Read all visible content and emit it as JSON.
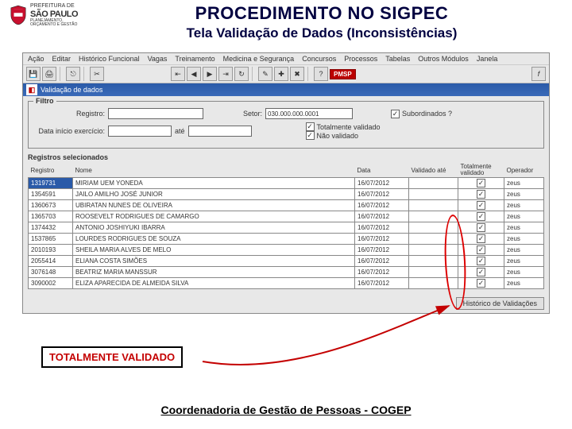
{
  "logo": {
    "line1": "PREFEITURA DE",
    "city": "SÃO PAULO",
    "line3": "PLANEJAMENTO,\nORÇAMENTO E GESTÃO"
  },
  "titles": {
    "main": "PROCEDIMENTO NO SIGPEC",
    "sub": "Tela Validação de Dados (Inconsistências)"
  },
  "menu": [
    "Ação",
    "Editar",
    "Histórico Funcional",
    "Vagas",
    "Treinamento",
    "Medicina e Segurança",
    "Concursos",
    "Processos",
    "Tabelas",
    "Outros Módulos",
    "Janela"
  ],
  "toolbar_badge": "PMSP",
  "window_title": "Validação de dados",
  "filtro": {
    "title": "Filtro",
    "registro_label": "Registro:",
    "setor_label": "Setor:",
    "setor_value": "030.000.000.0001",
    "subordinados_label": "Subordinados ?",
    "data_ini_label": "Data início exercício:",
    "ate_label": "até",
    "totvalid_label": "Totalmente validado",
    "naovalid_label": "Não validado"
  },
  "grid": {
    "section": "Registros selecionados",
    "headers": {
      "registro": "Registro",
      "nome": "Nome",
      "data": "Data",
      "valido_ate": "Validado até",
      "tot": "Totalmente validado",
      "operador": "Operador"
    },
    "rows": [
      {
        "reg": "1319731",
        "nome": "MIRIAM UEM YONEDA",
        "data": "16/07/2012",
        "op": "zeus",
        "sel": true
      },
      {
        "reg": "1354591",
        "nome": "JAILO AMILHO JOSÉ JUNIOR",
        "data": "16/07/2012",
        "op": "zeus"
      },
      {
        "reg": "1360673",
        "nome": "UBIRATAN NUNES DE OLIVEIRA",
        "data": "16/07/2012",
        "op": "zeus"
      },
      {
        "reg": "1365703",
        "nome": "ROOSEVELT RODRIGUES DE CAMARGO",
        "data": "16/07/2012",
        "op": "zeus"
      },
      {
        "reg": "1374432",
        "nome": "ANTONIO JOSHIYUKI IBARRA",
        "data": "16/07/2012",
        "op": "zeus"
      },
      {
        "reg": "1537865",
        "nome": "LOURDES RODRIGUES DE SOUZA",
        "data": "16/07/2012",
        "op": "zeus"
      },
      {
        "reg": "2010193",
        "nome": "SHEILA MARIA ALVES DE MELO",
        "data": "16/07/2012",
        "op": "zeus"
      },
      {
        "reg": "2055414",
        "nome": "ELIANA COSTA SIMÕES",
        "data": "16/07/2012",
        "op": "zeus"
      },
      {
        "reg": "3076148",
        "nome": "BEATRIZ MARIA MANSSUR",
        "data": "16/07/2012",
        "op": "zeus"
      },
      {
        "reg": "3090002",
        "nome": "ELIZA APARECIDA DE ALMEIDA SILVA",
        "data": "16/07/2012",
        "op": "zeus"
      }
    ],
    "hist_btn": "Histórico de Validações"
  },
  "callout": "TOTALMENTE VALIDADO",
  "footer": "Coordenadoria de Gestão de Pessoas - COGEP",
  "check_glyph": "✓"
}
